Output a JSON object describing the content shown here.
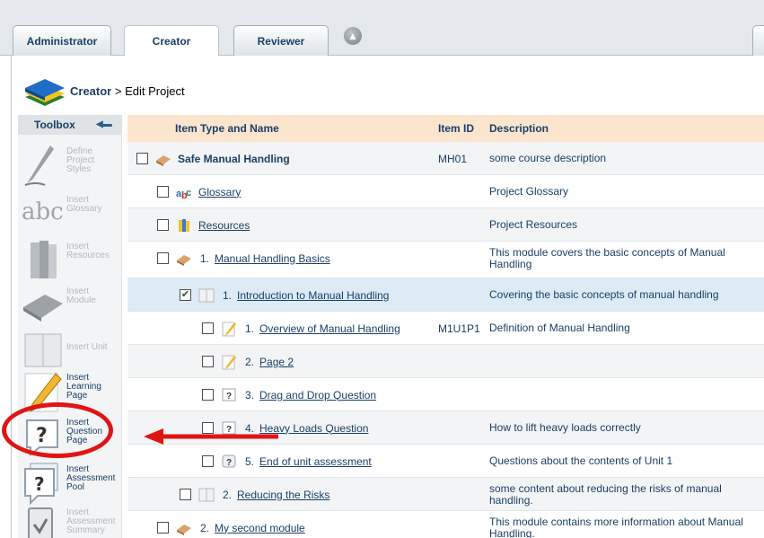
{
  "tabs": [
    {
      "label": "Administrator",
      "active": false
    },
    {
      "label": "Creator",
      "active": true
    },
    {
      "label": "Reviewer",
      "active": false
    }
  ],
  "breadcrumb": {
    "current": "Creator",
    "separator": " > ",
    "page": "Edit Project"
  },
  "toolbox": {
    "title": "Toolbox",
    "tools": [
      {
        "label": "Define Project Styles",
        "icon": "pen-icon",
        "enabled": false
      },
      {
        "label": "Insert Glossary",
        "icon": "abc-icon",
        "enabled": false
      },
      {
        "label": "Insert Resources",
        "icon": "binders-icon",
        "enabled": false
      },
      {
        "label": "Insert Module",
        "icon": "book-icon",
        "enabled": false
      },
      {
        "label": "Insert Unit",
        "icon": "open-book-icon",
        "enabled": false
      },
      {
        "label": "Insert Learning Page",
        "icon": "pencil-icon",
        "enabled": true
      },
      {
        "label": "Insert Question Page",
        "icon": "question-page-icon",
        "enabled": true
      },
      {
        "label": "Insert Assessment Pool",
        "icon": "assessment-pool-icon",
        "enabled": true
      },
      {
        "label": "Insert Assessment Summary",
        "icon": "clipboard-icon",
        "enabled": false
      }
    ]
  },
  "table": {
    "headers": {
      "name": "Item Type and Name",
      "id": "Item ID",
      "description": "Description"
    },
    "rows": [
      {
        "level": 0,
        "icon": "course-icon",
        "number": "",
        "name": "Safe Manual Handling",
        "bold": true,
        "link": false,
        "id": "MH01",
        "description": "some course description",
        "checked": false
      },
      {
        "level": 1,
        "icon": "glossary-icon",
        "number": "",
        "name": "Glossary",
        "bold": false,
        "link": true,
        "id": "",
        "description": "Project Glossary",
        "checked": false
      },
      {
        "level": 1,
        "icon": "resources-icon",
        "number": "",
        "name": "Resources",
        "bold": false,
        "link": true,
        "id": "",
        "description": "Project Resources",
        "checked": false
      },
      {
        "level": 1,
        "icon": "module-icon",
        "number": "1.",
        "name": "Manual Handling Basics",
        "bold": false,
        "link": true,
        "id": "",
        "description": "This module covers the basic concepts of Manual Handling",
        "checked": false
      },
      {
        "level": 2,
        "icon": "unit-icon",
        "number": "1.",
        "name": "Introduction to Manual Handling",
        "bold": false,
        "link": true,
        "id": "",
        "description": "Covering the basic concepts of manual handling",
        "checked": true
      },
      {
        "level": 3,
        "icon": "page-icon",
        "number": "1.",
        "name": "Overview of Manual Handling",
        "bold": false,
        "link": true,
        "id": "M1U1P1",
        "description": "Definition of Manual Handling",
        "checked": false
      },
      {
        "level": 3,
        "icon": "page-icon",
        "number": "2.",
        "name": "Page 2",
        "bold": false,
        "link": true,
        "id": "",
        "description": "",
        "checked": false
      },
      {
        "level": 3,
        "icon": "question-icon",
        "number": "3.",
        "name": "Drag and Drop Question",
        "bold": false,
        "link": true,
        "id": "",
        "description": "",
        "checked": false
      },
      {
        "level": 3,
        "icon": "question-icon",
        "number": "4.",
        "name": "Heavy Loads Question",
        "bold": false,
        "link": true,
        "id": "",
        "description": "How to lift heavy loads correctly",
        "checked": false
      },
      {
        "level": 3,
        "icon": "assessment-icon",
        "number": "5.",
        "name": "End of unit assessment",
        "bold": false,
        "link": true,
        "id": "",
        "description": "Questions about the contents of Unit 1",
        "checked": false
      },
      {
        "level": 2,
        "icon": "unit-icon",
        "number": "2.",
        "name": "Reducing the Risks",
        "bold": false,
        "link": true,
        "id": "",
        "description": "some content about reducing the risks of manual handling.",
        "checked": false
      },
      {
        "level": 1,
        "icon": "module-icon",
        "number": "2.",
        "name": "My second module",
        "bold": false,
        "link": true,
        "id": "",
        "description": "This module contains more information about Manual Handling.",
        "checked": false
      }
    ]
  },
  "colors": {
    "accent": "#1b3f66",
    "header_bg": "#fbe5cf",
    "selected_row": "#dcebf6",
    "annotation": "#e11414"
  }
}
